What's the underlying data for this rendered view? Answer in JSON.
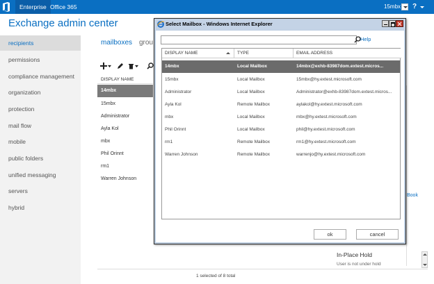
{
  "topbar": {
    "tabs": [
      "Enterprise",
      "Office 365"
    ],
    "user": "15mbx",
    "help_label": "?"
  },
  "app_title": "Exchange admin center",
  "nav": {
    "items": [
      "recipients",
      "permissions",
      "compliance management",
      "organization",
      "protection",
      "mail flow",
      "mobile",
      "public folders",
      "unified messaging",
      "servers",
      "hybrid"
    ],
    "active_index": 0
  },
  "main": {
    "tabs": [
      "mailboxes",
      "grou"
    ],
    "toolbar_icons": [
      "add-icon",
      "edit-icon",
      "delete-icon",
      "search-icon"
    ],
    "column_header": "DISPLAY NAME",
    "rows": [
      "14mbx",
      "15mbx",
      "Administrator",
      "Ayla Kol",
      "mbx",
      "Phil Orinnt",
      "rm1",
      "Warren Johnson"
    ],
    "selected_index": 0,
    "status": "1 selected of 8 total"
  },
  "details": {
    "partial_link": "Book",
    "inplace_hold_title": "In-Place Hold",
    "inplace_hold_value": "User is not under hold"
  },
  "dialog": {
    "title": "Select Mailbox - Windows Internet Explorer",
    "help_link": "Help",
    "search_value": "",
    "columns": [
      "DISPLAY NAME",
      "TYPE",
      "EMAIL ADDRESS"
    ],
    "rows": [
      {
        "name": "14mbx",
        "type": "Local Mailbox",
        "email": "14mbx@exhb-83987dom.extest.micros..."
      },
      {
        "name": "15mbx",
        "type": "Local Mailbox",
        "email": "15mbx@hy.extest.microsoft.com"
      },
      {
        "name": "Administrator",
        "type": "Local Mailbox",
        "email": "Administrator@exhb-83987dom.extest.micros..."
      },
      {
        "name": "Ayla Kol",
        "type": "Remote Mailbox",
        "email": "aylakol@hy.extest.microsoft.com"
      },
      {
        "name": "mbx",
        "type": "Local Mailbox",
        "email": "mbx@hy.extest.microsoft.com"
      },
      {
        "name": "Phil Orinnt",
        "type": "Local Mailbox",
        "email": "phil@hy.extest.microsoft.com"
      },
      {
        "name": "rm1",
        "type": "Remote Mailbox",
        "email": "rm1@hy.extest.microsoft.com"
      },
      {
        "name": "Warren Johnson",
        "type": "Remote Mailbox",
        "email": "warrenjo@hy.extest.microsoft.com"
      }
    ],
    "selected_index": 0,
    "ok_label": "ok",
    "cancel_label": "cancel"
  },
  "colors": {
    "topbar": "#0a6fc2",
    "accent": "#0a6fc2",
    "selected_row": "#6b6b6b",
    "nav_background": "#f2f2f2"
  }
}
